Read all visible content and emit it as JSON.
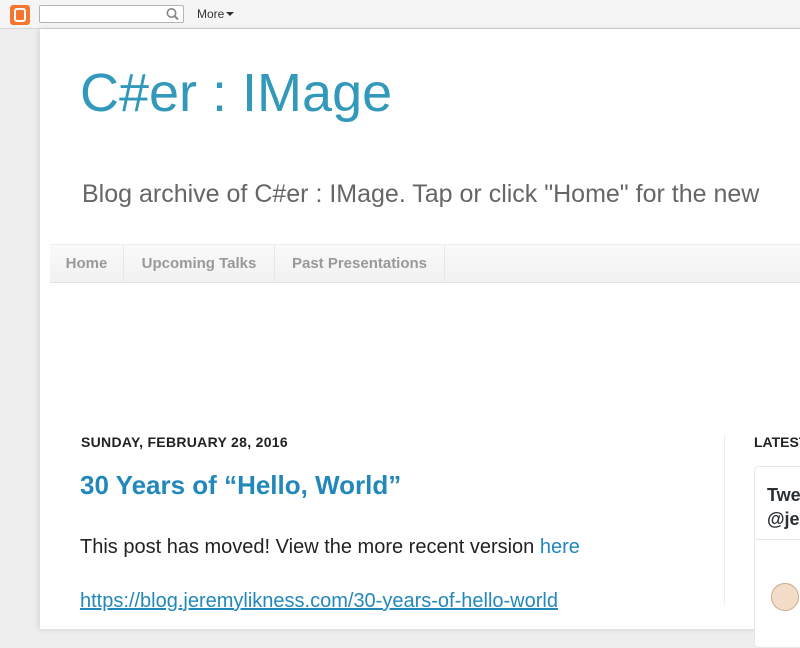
{
  "navbar": {
    "search_placeholder": "",
    "more_label": "More"
  },
  "blog": {
    "title": "C#er : IMage",
    "description": "Blog archive of C#er : IMage. Tap or click \"Home\" for the new"
  },
  "tabs": [
    {
      "label": "Home"
    },
    {
      "label": "Upcoming Talks"
    },
    {
      "label": "Past Presentations"
    }
  ],
  "post": {
    "date": "SUNDAY, FEBRUARY 28, 2016",
    "title": "30 Years of “Hello, World”",
    "body_text": "This post has moved! View the more recent version ",
    "body_link": "here",
    "url_text": "https://blog.jeremylikness.com/30-years-of-hello-world"
  },
  "sidebar": {
    "title": "LATEST",
    "tweet_header_line1": "Twe",
    "tweet_header_line2": "@je"
  },
  "colors": {
    "title": "#3399bb",
    "link": "#2288bb",
    "blogger_orange": "#f6762f"
  },
  "icons": [
    "blogger-logo-icon",
    "search-icon",
    "caret-down-icon"
  ]
}
